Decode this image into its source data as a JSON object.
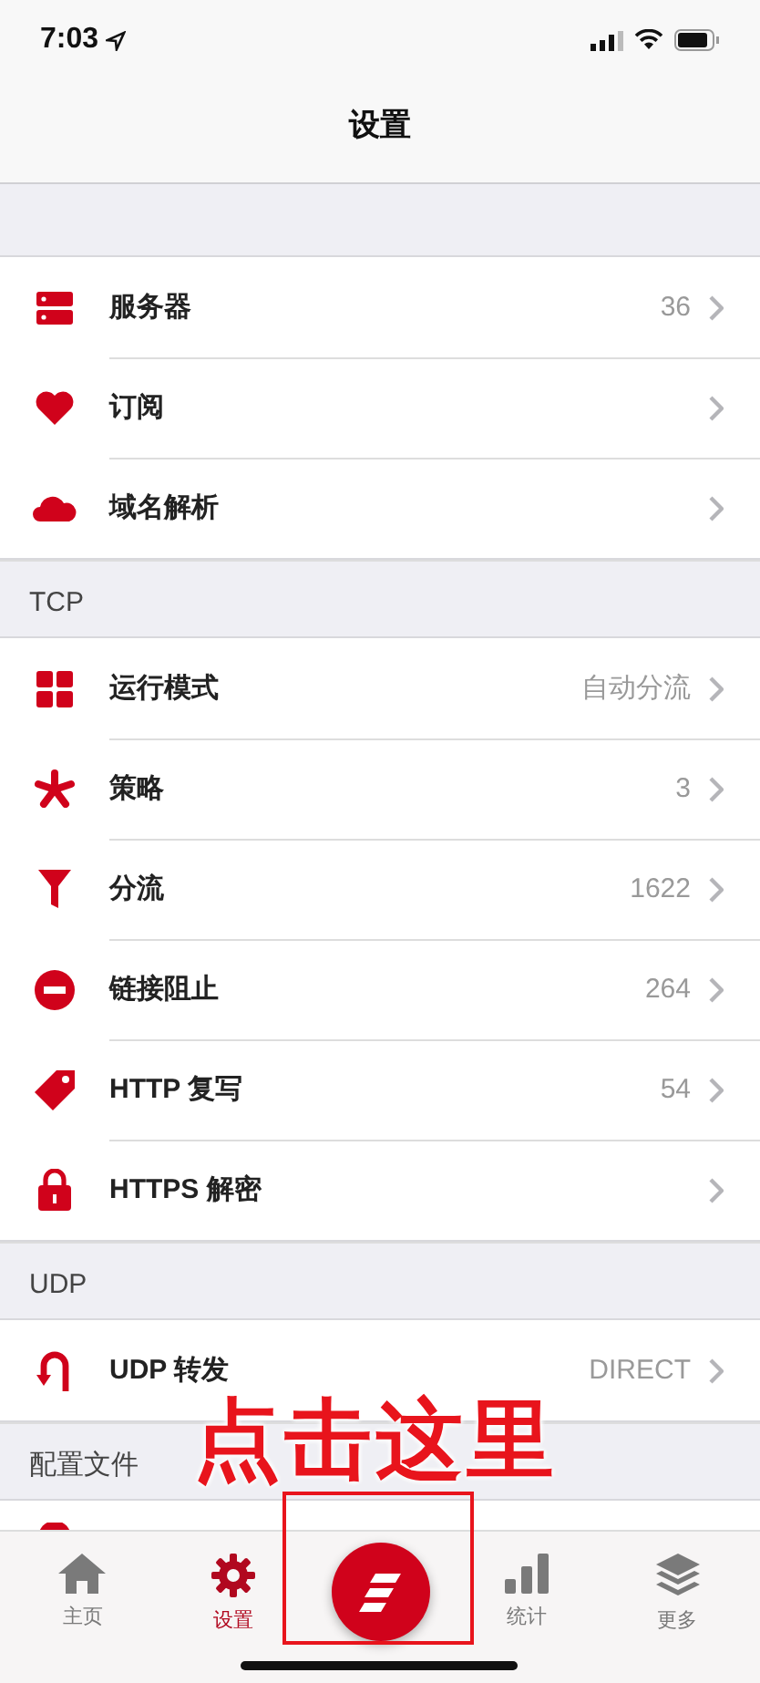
{
  "status_bar": {
    "time": "7:03"
  },
  "nav": {
    "title": "设置"
  },
  "sections": [
    {
      "rows": [
        {
          "kind": "server",
          "label": "服务器",
          "value": "36"
        },
        {
          "kind": "heart",
          "label": "订阅"
        },
        {
          "kind": "cloud",
          "label": "域名解析"
        }
      ]
    },
    {
      "header": "TCP",
      "rows": [
        {
          "kind": "grid",
          "label": "运行模式",
          "value": "自动分流"
        },
        {
          "kind": "asterisk",
          "label": "策略",
          "value": "3"
        },
        {
          "kind": "funnel",
          "label": "分流",
          "value": "1622"
        },
        {
          "kind": "block",
          "label": "链接阻止",
          "value": "264"
        },
        {
          "kind": "tag",
          "label": "HTTP 复写",
          "value": "54"
        },
        {
          "kind": "lock",
          "label": "HTTPS 解密"
        }
      ]
    },
    {
      "header": "UDP",
      "rows": [
        {
          "kind": "uturn",
          "label": "UDP 转发",
          "value": "DIRECT"
        }
      ]
    },
    {
      "header": "配置文件",
      "rows": [
        {
          "kind": "partial"
        }
      ]
    }
  ],
  "tabs": [
    {
      "kind": "home",
      "label": "主页",
      "selected": false
    },
    {
      "kind": "gear",
      "label": "设置",
      "selected": true
    },
    {
      "kind": "center",
      "selected": false
    },
    {
      "kind": "bars",
      "label": "统计",
      "selected": false
    },
    {
      "kind": "layers",
      "label": "更多",
      "selected": false
    }
  ],
  "annotation": {
    "text": "点击这里"
  }
}
